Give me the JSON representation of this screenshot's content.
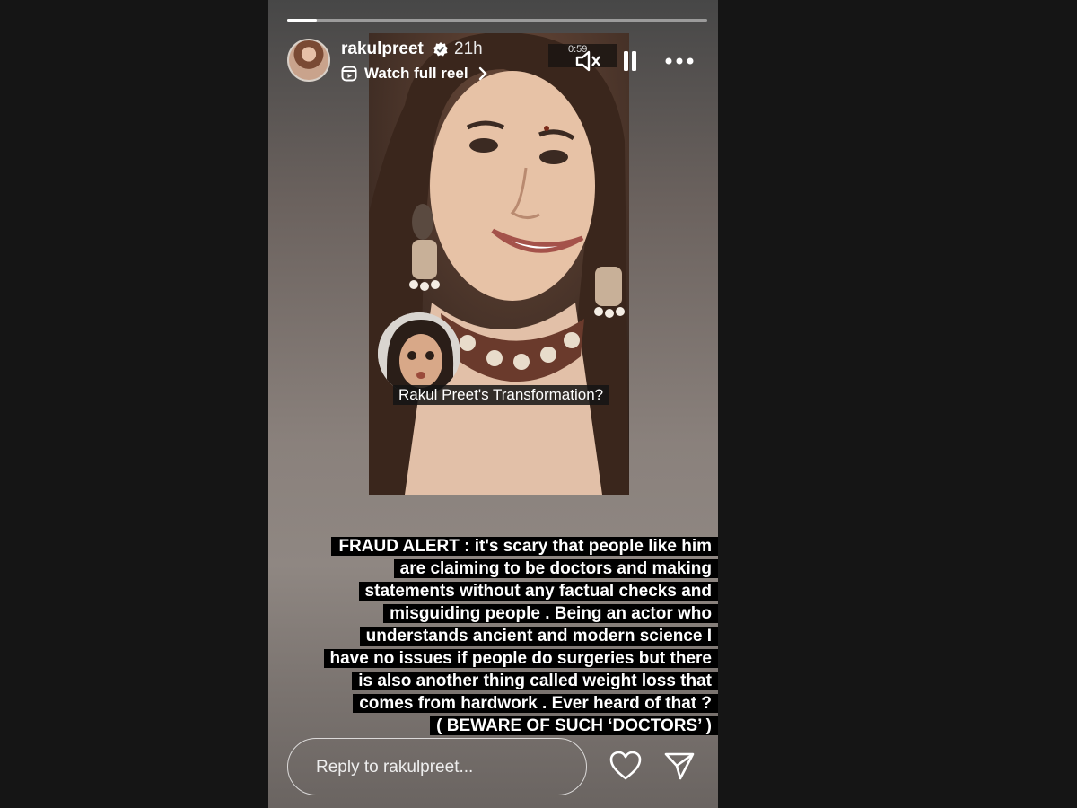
{
  "story": {
    "progress_fraction": 0.07,
    "username": "rakulpreet",
    "time_ago": "21h",
    "watch_reel_label": "Watch full reel",
    "video_time": "0:59",
    "overlay_caption": "Rakul Preet's Transformation?"
  },
  "alert_lines": [
    "FRAUD ALERT : it's scary that people like him",
    "are claiming to be doctors and  making",
    "statements without any factual checks and",
    "misguiding people . Being an actor who",
    "understands ancient and modern science I",
    "have no issues if people do surgeries but there",
    "is also another thing called weight loss that",
    "comes from hardwork . Ever heard of  that ?",
    "( BEWARE OF SUCH ‘DOCTORS’ )"
  ],
  "reply": {
    "placeholder": "Reply to rakulpreet..."
  },
  "icons": {
    "verified": "verified-badge-icon",
    "reel": "reel-icon",
    "chevron": "chevron-right-icon",
    "mute": "mute-icon",
    "pause": "pause-icon",
    "more": "more-icon",
    "heart": "heart-icon",
    "send": "send-icon"
  },
  "colors": {
    "page_background": "#151515",
    "verified_blue": "#ffffff"
  }
}
